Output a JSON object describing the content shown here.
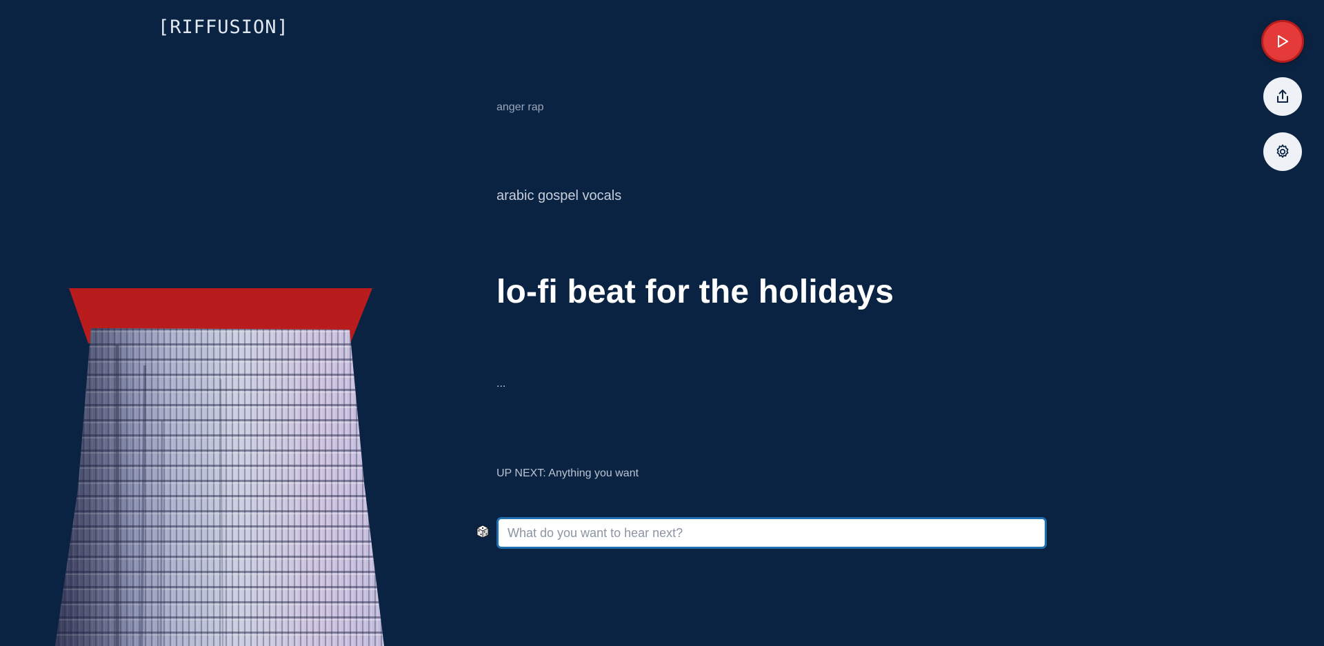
{
  "app": {
    "logo_text": "[RIFFUSION]"
  },
  "prompts": {
    "previous_2": "anger rap",
    "previous_1": "arabic gospel vocals",
    "current": "lo-fi beat for the holidays",
    "next": "..."
  },
  "up_next": {
    "label": "UP NEXT: Anything you want"
  },
  "prompt_input": {
    "value": "",
    "placeholder": "What do you want to hear next?"
  },
  "controls": {
    "play_icon": "play-icon",
    "share_icon": "share-icon",
    "settings_icon": "gear-icon",
    "dice_icon": "dice-icon"
  },
  "colors": {
    "background": "#0b2342",
    "accent_red": "#e53a3a",
    "spectrogram_top": "#b91c1c",
    "input_border": "#1f6fb0"
  }
}
